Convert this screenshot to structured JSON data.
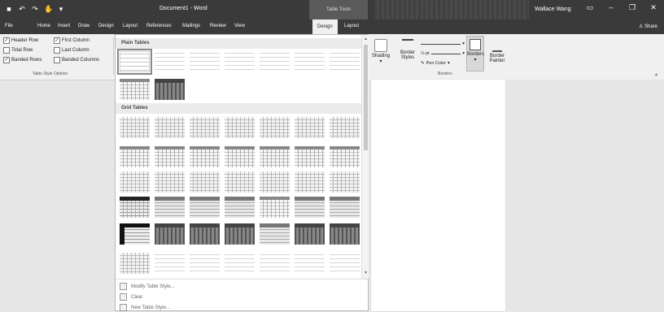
{
  "titlebar": {
    "document_title": "Document1 - Word",
    "context_tools": "Table Tools",
    "user": "Wallace Wang"
  },
  "tabs": [
    {
      "label": "File"
    },
    {
      "label": "Home"
    },
    {
      "label": "Insert"
    },
    {
      "label": "Draw"
    },
    {
      "label": "Design"
    },
    {
      "label": "Layout"
    },
    {
      "label": "References"
    },
    {
      "label": "Mailings"
    },
    {
      "label": "Review"
    },
    {
      "label": "View"
    },
    {
      "label": "Design"
    },
    {
      "label": "Layout"
    }
  ],
  "share_label": "Share",
  "table_style_options": {
    "header_row": "Header Row",
    "first_column": "First Column",
    "total_row": "Total Row",
    "last_column": "Last Column",
    "banded_rows": "Banded Rows",
    "banded_columns": "Banded Columns",
    "group_label": "Table Style Options"
  },
  "gallery": {
    "plain_tables": "Plain Tables",
    "grid_tables": "Grid Tables",
    "modify": "Modify Table Style...",
    "clear": "Clear",
    "new_style": "New Table Style..."
  },
  "borders": {
    "shading": "Shading",
    "border_styles": "Border Styles",
    "weight": "½ pt",
    "pen_color": "Pen Color",
    "borders": "Borders",
    "border_painter": "Border Painter",
    "group_label": "Borders"
  }
}
